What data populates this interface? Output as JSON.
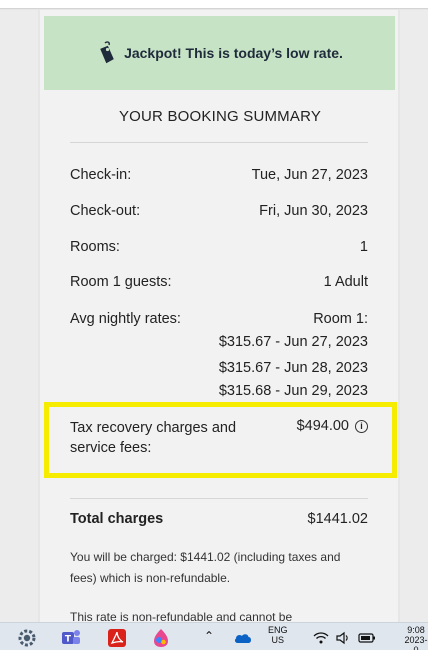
{
  "banner": {
    "text": "Jackpot! This is today’s low rate.",
    "icon": "price-tag-icon"
  },
  "summary": {
    "title": "YOUR BOOKING SUMMARY",
    "checkin_label": "Check-in:",
    "checkin_value": "Tue, Jun 27, 2023",
    "checkout_label": "Check-out:",
    "checkout_value": "Fri, Jun 30, 2023",
    "rooms_label": "Rooms:",
    "rooms_value": "1",
    "guests_label": "Room 1 guests:",
    "guests_value": "1 Adult",
    "rates_label": "Avg nightly rates:",
    "rates_room": "Room 1:",
    "rates": [
      "$315.67 - Jun 27, 2023",
      "$315.67 - Jun 28, 2023",
      "$315.68 - Jun 29, 2023"
    ],
    "tax_label": "Tax recovery charges and service fees:",
    "tax_value": "$494.00",
    "total_label": "Total charges",
    "total_value": "$1441.02",
    "charge_note": "You will be charged: $1441.02 (including taxes and fees) which is non-refundable.",
    "refund_note": "This rate is non-refundable and cannot be"
  },
  "taskbar": {
    "apps": [
      "settings-icon",
      "teams-icon",
      "acrobat-icon",
      "paint-icon"
    ],
    "lang": "ENG",
    "region": "US",
    "time": "9:08",
    "date": "2023-0"
  },
  "colors": {
    "banner_bg": "#c6e3c6",
    "highlight": "#f5ec00"
  }
}
